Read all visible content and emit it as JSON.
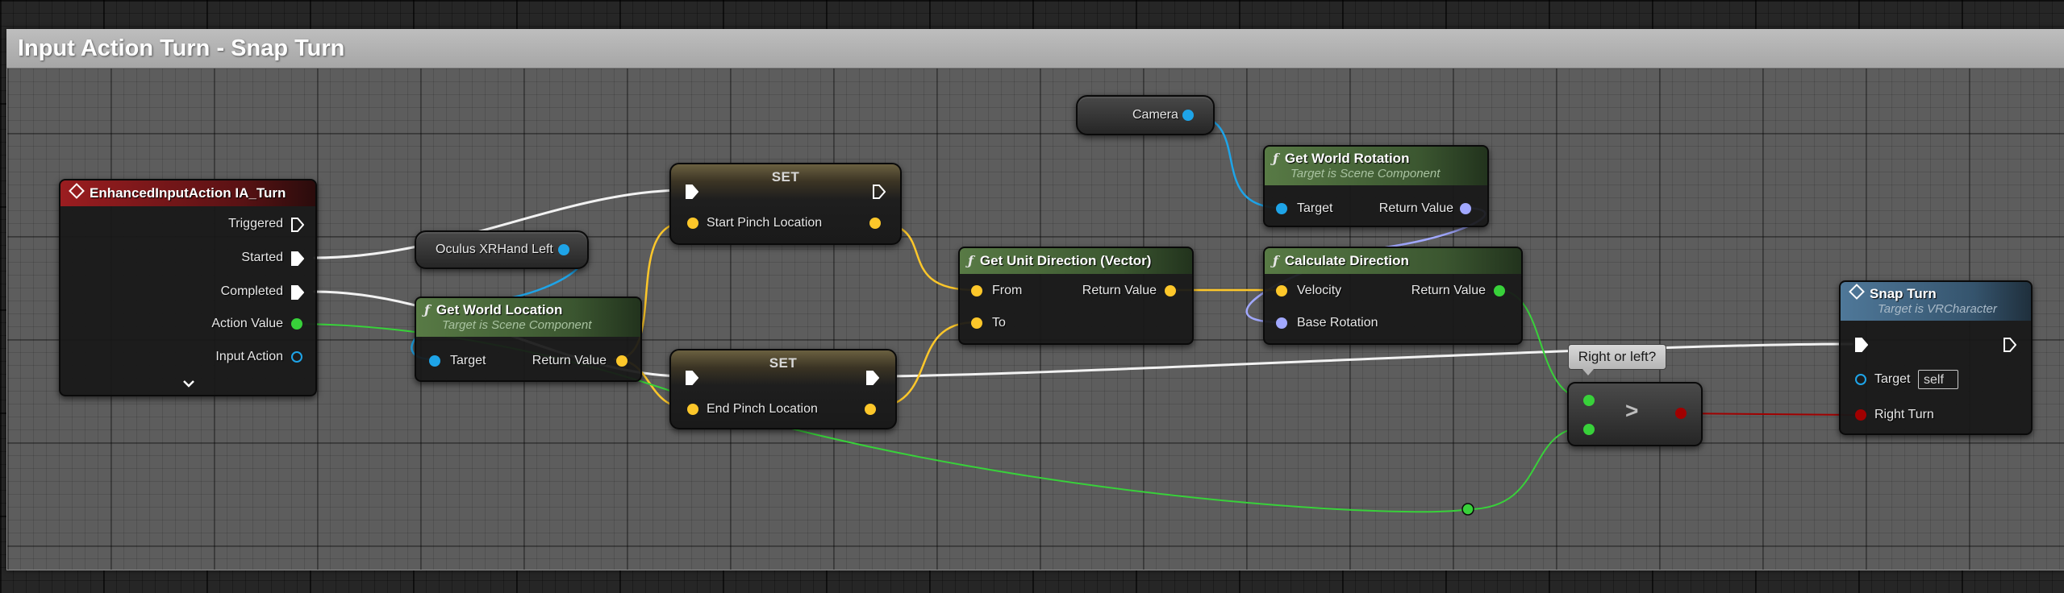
{
  "comment": {
    "title": "Input Action Turn - Snap Turn"
  },
  "nodes": {
    "enhanced_input": {
      "title": "EnhancedInputAction IA_Turn",
      "pins": [
        "Triggered",
        "Started",
        "Completed",
        "Action Value",
        "Input Action"
      ],
      "expand_icon": "chevron-down-icon"
    },
    "oculus_var": {
      "label": "Oculus XRHand Left"
    },
    "camera_var": {
      "label": "Camera"
    },
    "get_world_location": {
      "title": "Get World Location",
      "subtitle": "Target is Scene Component",
      "input": "Target",
      "output": "Return Value"
    },
    "set_start": {
      "title": "SET",
      "input": "Start Pinch Location"
    },
    "set_end": {
      "title": "SET",
      "input": "End Pinch Location"
    },
    "get_unit_direction": {
      "title": "Get Unit Direction (Vector)",
      "inputs": [
        "From",
        "To"
      ],
      "output": "Return Value"
    },
    "get_world_rotation": {
      "title": "Get World Rotation",
      "subtitle": "Target is Scene Component",
      "input": "Target",
      "output": "Return Value"
    },
    "calculate_direction": {
      "title": "Calculate Direction",
      "inputs": [
        "Velocity",
        "Base Rotation"
      ],
      "output": "Return Value"
    },
    "compare": {
      "symbol": ">",
      "comment": "Right or left?"
    },
    "snap_turn": {
      "title": "Snap Turn",
      "subtitle": "Target is VRCharacter",
      "inputs": [
        "Target",
        "Right Turn"
      ],
      "target_default": "self"
    }
  },
  "colors": {
    "exec": "#ffffff",
    "vector": "#fdc72a",
    "object": "#1ea4e8",
    "rotator": "#a1a8ff",
    "float": "#38d13a",
    "bool": "#a10000",
    "event_header": "#9b1d20",
    "function_header": "#587a45",
    "target_header": "#4f7899"
  }
}
